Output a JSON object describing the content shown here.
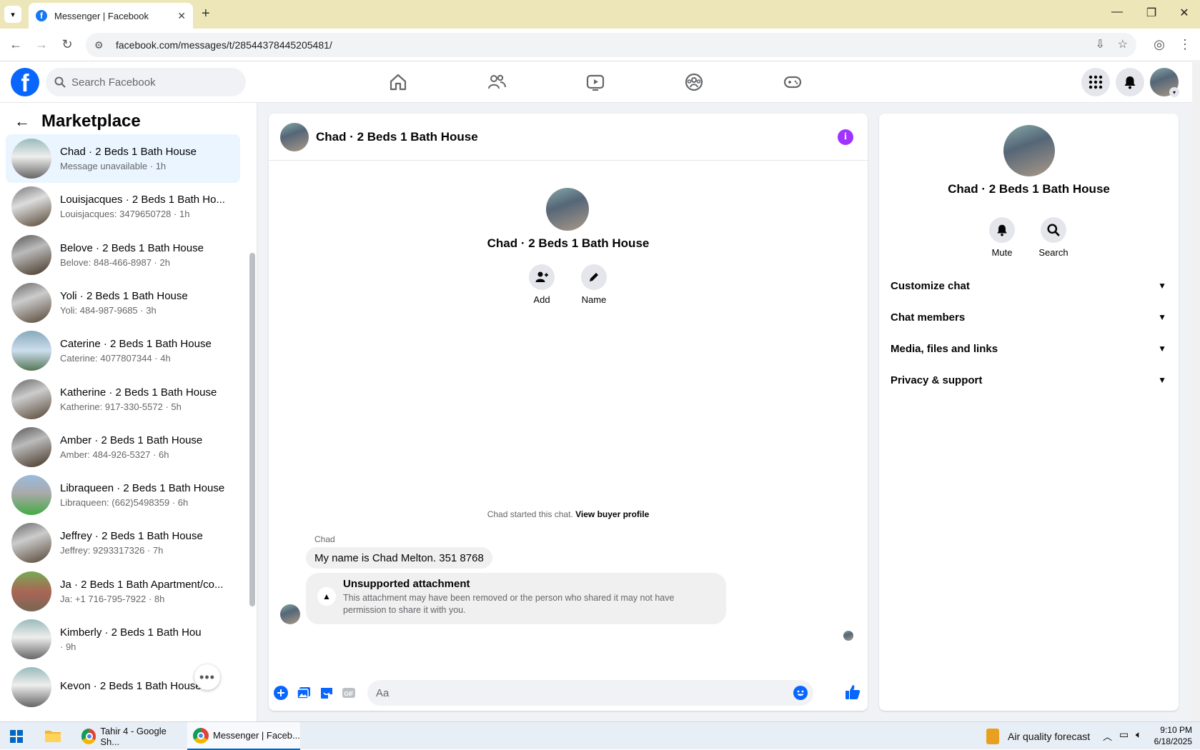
{
  "browser": {
    "tab_title": "Messenger | Facebook",
    "tab_close": "✕",
    "new_tab": "+",
    "url": "facebook.com/messages/t/28544378445205481/"
  },
  "fb": {
    "search_placeholder": "Search Facebook",
    "logo_letter": "f"
  },
  "sidebar": {
    "title": "Marketplace",
    "conversations": [
      {
        "name": "Chad · 2 Beds 1 Bath House",
        "sub": "Message unavailable · 1h",
        "active": true
      },
      {
        "name": "Louisjacques · 2 Beds 1 Bath Ho...",
        "sub": "Louisjacques: 3479650728 · 1h"
      },
      {
        "name": "Belove · 2 Beds 1 Bath House",
        "sub": "Belove: 848-466-8987 · 2h"
      },
      {
        "name": "Yoli · 2 Beds 1 Bath House",
        "sub": "Yoli: 484-987-9685 · 3h"
      },
      {
        "name": "Caterine · 2 Beds 1 Bath House",
        "sub": "Caterine: 4077807344 · 4h"
      },
      {
        "name": "Katherine · 2 Beds 1 Bath House",
        "sub": "Katherine: 917-330-5572 · 5h"
      },
      {
        "name": "Amber · 2 Beds 1 Bath House",
        "sub": "Amber: 484-926-5327 · 6h"
      },
      {
        "name": "Libraqueen · 2 Beds 1 Bath House",
        "sub": "Libraqueen: (662)5498359 · 6h"
      },
      {
        "name": "Jeffrey · 2 Beds 1 Bath House",
        "sub": "Jeffrey: 9293317326 · 7h"
      },
      {
        "name": "Ja · 2 Beds 1 Bath Apartment/co...",
        "sub": "Ja: +1 716-795-7922 · 8h"
      },
      {
        "name": "Kimberly · 2 Beds 1 Bath Hou",
        "sub": "· 9h"
      },
      {
        "name": "Kevon · 2 Beds 1 Bath House",
        "sub": ""
      }
    ],
    "more_label": "•••"
  },
  "chat": {
    "title": "Chad · 2 Beds 1 Bath House",
    "info_label": "i",
    "center_name": "Chad · 2 Beds 1 Bath House",
    "add_label": "Add",
    "name_label": "Name",
    "started_text": "Chad started this chat.",
    "view_profile": "View buyer profile",
    "sender": "Chad",
    "message1": "My name is Chad Melton. 351 8768",
    "attachment_title": "Unsupported attachment",
    "attachment_desc": "This attachment may have been removed or the person who shared it may not have permission to share it with you.",
    "input_placeholder": "Aa"
  },
  "right_panel": {
    "name": "Chad · 2 Beds 1 Bath House",
    "mute_label": "Mute",
    "search_label": "Search",
    "sections": [
      "Customize chat",
      "Chat members",
      "Media, files and links",
      "Privacy & support"
    ]
  },
  "taskbar": {
    "app1": "Tahir 4 - Google Sh...",
    "app2": "Messenger | Faceb...",
    "weather": "Air quality forecast",
    "time": "9:10 PM",
    "date": "6/18/2025"
  },
  "colors": {
    "fb_blue": "#0866ff",
    "active_conv": "#ebf5ff",
    "info_purple": "#a033ff"
  }
}
